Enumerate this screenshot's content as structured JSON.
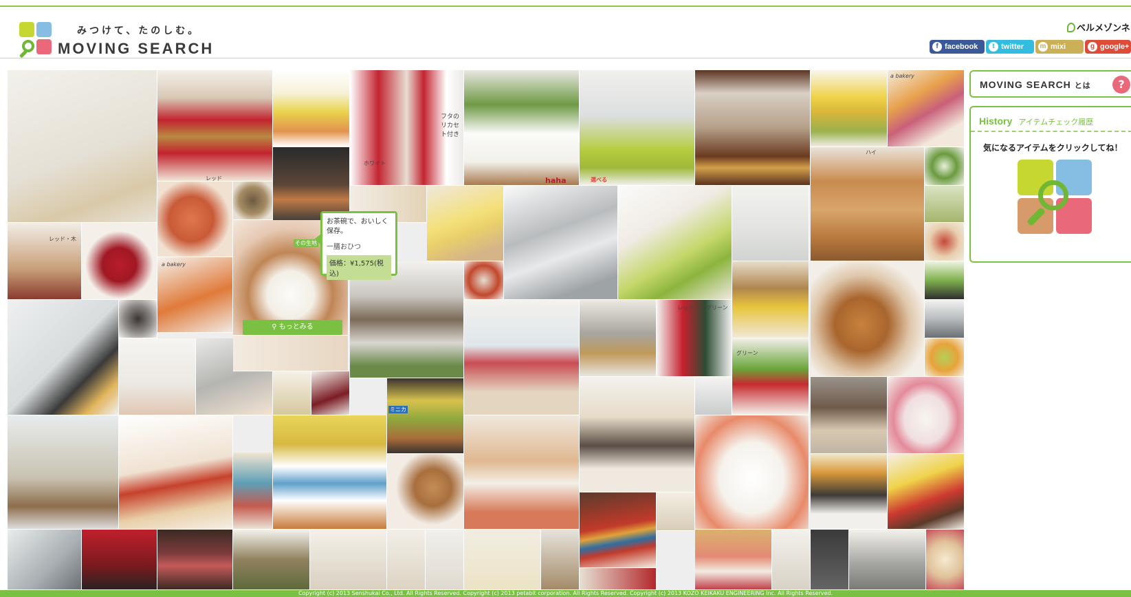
{
  "header": {
    "tagline": "みつけて、たのしむ。",
    "title": "MOVING SEARCH",
    "brand": "ベルメゾンネット"
  },
  "social": {
    "facebook": "facebook",
    "twitter": "twitter",
    "mixi": "mixi",
    "google": "google+"
  },
  "tooltip": {
    "description": "お茶碗で、おいしく保存。",
    "name": "一膳おひつ",
    "price": "価格：¥1,575(税込)",
    "more": "もっとみる"
  },
  "tile_labels": {
    "a": "レッド",
    "b": "レッド・木",
    "c": "a bakery",
    "d": "a bakery",
    "e": "ハイ",
    "f": "レッド",
    "g": "グリーン",
    "h": "グリーン",
    "i": "ホワイト",
    "j": "レッド",
    "k": "フタの\nリカセ\nト付き",
    "l": "haha",
    "m": "選べる",
    "n": "その生地",
    "o": "ミニカ"
  },
  "sidebar": {
    "about_title": "MOVING SEARCH",
    "about_suffix": "とは",
    "help": "?",
    "history_en": "History",
    "history_jp": "アイテムチェック履歴",
    "history_msg": "気になるアイテムをクリックしてね！"
  },
  "footer": {
    "copyright": "Copyright (c) 2013 Senshukai Co., Ltd. All Rights Reserved.   Copyright (c) 2013 petabit corporation. All Rights Reserved.   Copyright (c) 2013 KOZO KEIKAKU ENGINEERING Inc. All Rights Reserved."
  },
  "colors": {
    "accent": "#7ac043",
    "logo_yellow": "#c6d732",
    "logo_blue": "#86bde3",
    "logo_pink": "#e9687a",
    "logo_tan": "#d79b6b"
  }
}
